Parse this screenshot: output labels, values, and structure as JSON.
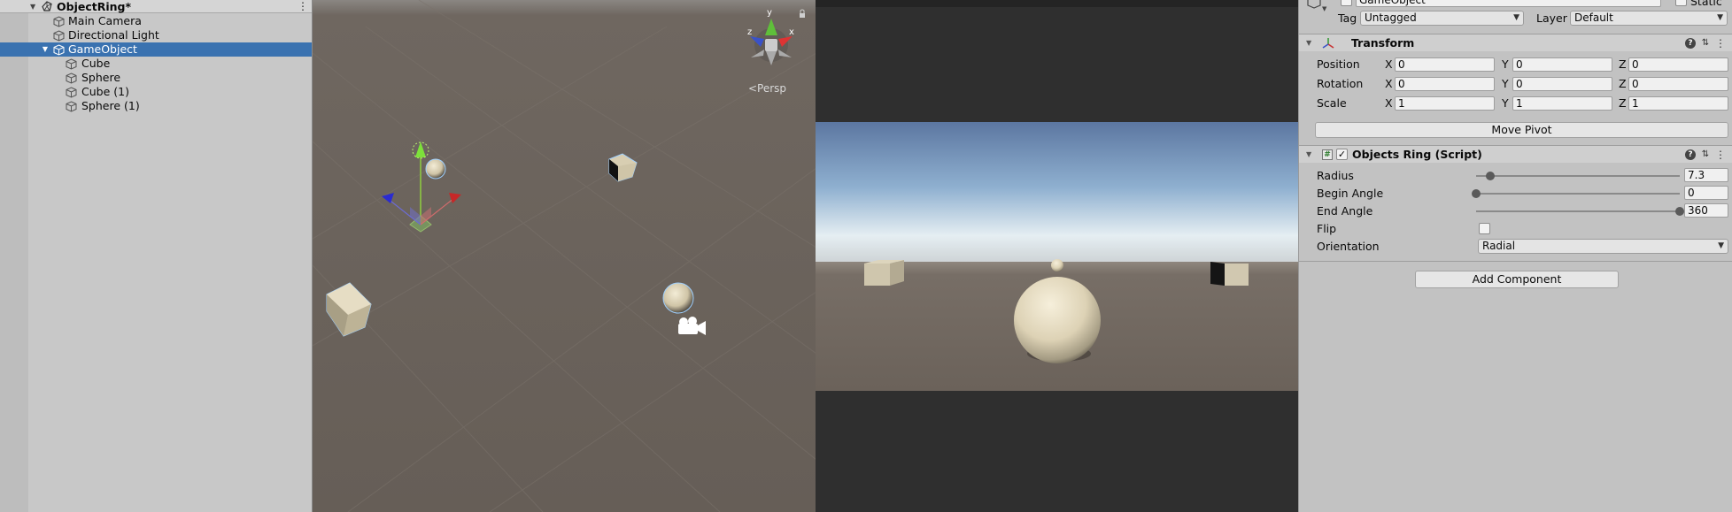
{
  "hierarchy": {
    "scene_name": "ObjectRing*",
    "items": [
      {
        "label": "Main Camera"
      },
      {
        "label": "Directional Light"
      },
      {
        "label": "GameObject"
      },
      {
        "label": "Cube"
      },
      {
        "label": "Sphere"
      },
      {
        "label": "Cube (1)"
      },
      {
        "label": "Sphere (1)"
      }
    ],
    "selected": "GameObject"
  },
  "scene_view": {
    "projection_label": "<Persp",
    "gizmo_axes": {
      "y": "y",
      "x": "x",
      "z": "z"
    }
  },
  "inspector": {
    "object_name": "GameObject",
    "static_label": "Static",
    "tag_label": "Tag",
    "tag_value": "Untagged",
    "layer_label": "Layer",
    "layer_value": "Default",
    "transform": {
      "title": "Transform",
      "rows": [
        {
          "label": "Position",
          "x": "0",
          "y": "0",
          "z": "0"
        },
        {
          "label": "Rotation",
          "x": "0",
          "y": "0",
          "z": "0"
        },
        {
          "label": "Scale",
          "x": "1",
          "y": "1",
          "z": "1"
        }
      ],
      "axis_x": "X",
      "axis_y": "Y",
      "axis_z": "Z",
      "move_pivot": "Move Pivot"
    },
    "objects_ring": {
      "title": "Objects Ring (Script)",
      "radius": {
        "label": "Radius",
        "value": "7.3",
        "fraction": 0.07
      },
      "begin_angle": {
        "label": "Begin Angle",
        "value": "0",
        "fraction": 0.0
      },
      "end_angle": {
        "label": "End Angle",
        "value": "360",
        "fraction": 1.0
      },
      "flip": {
        "label": "Flip",
        "checked": false
      },
      "orientation": {
        "label": "Orientation",
        "value": "Radial"
      }
    },
    "add_component": "Add Component"
  },
  "colors": {
    "selection": "#3a72b0",
    "scene_ground": "#6b635c",
    "game_sky_top": "#5f7aa3",
    "game_ground": "#6f655d",
    "object_color": "#d9cfb4"
  }
}
